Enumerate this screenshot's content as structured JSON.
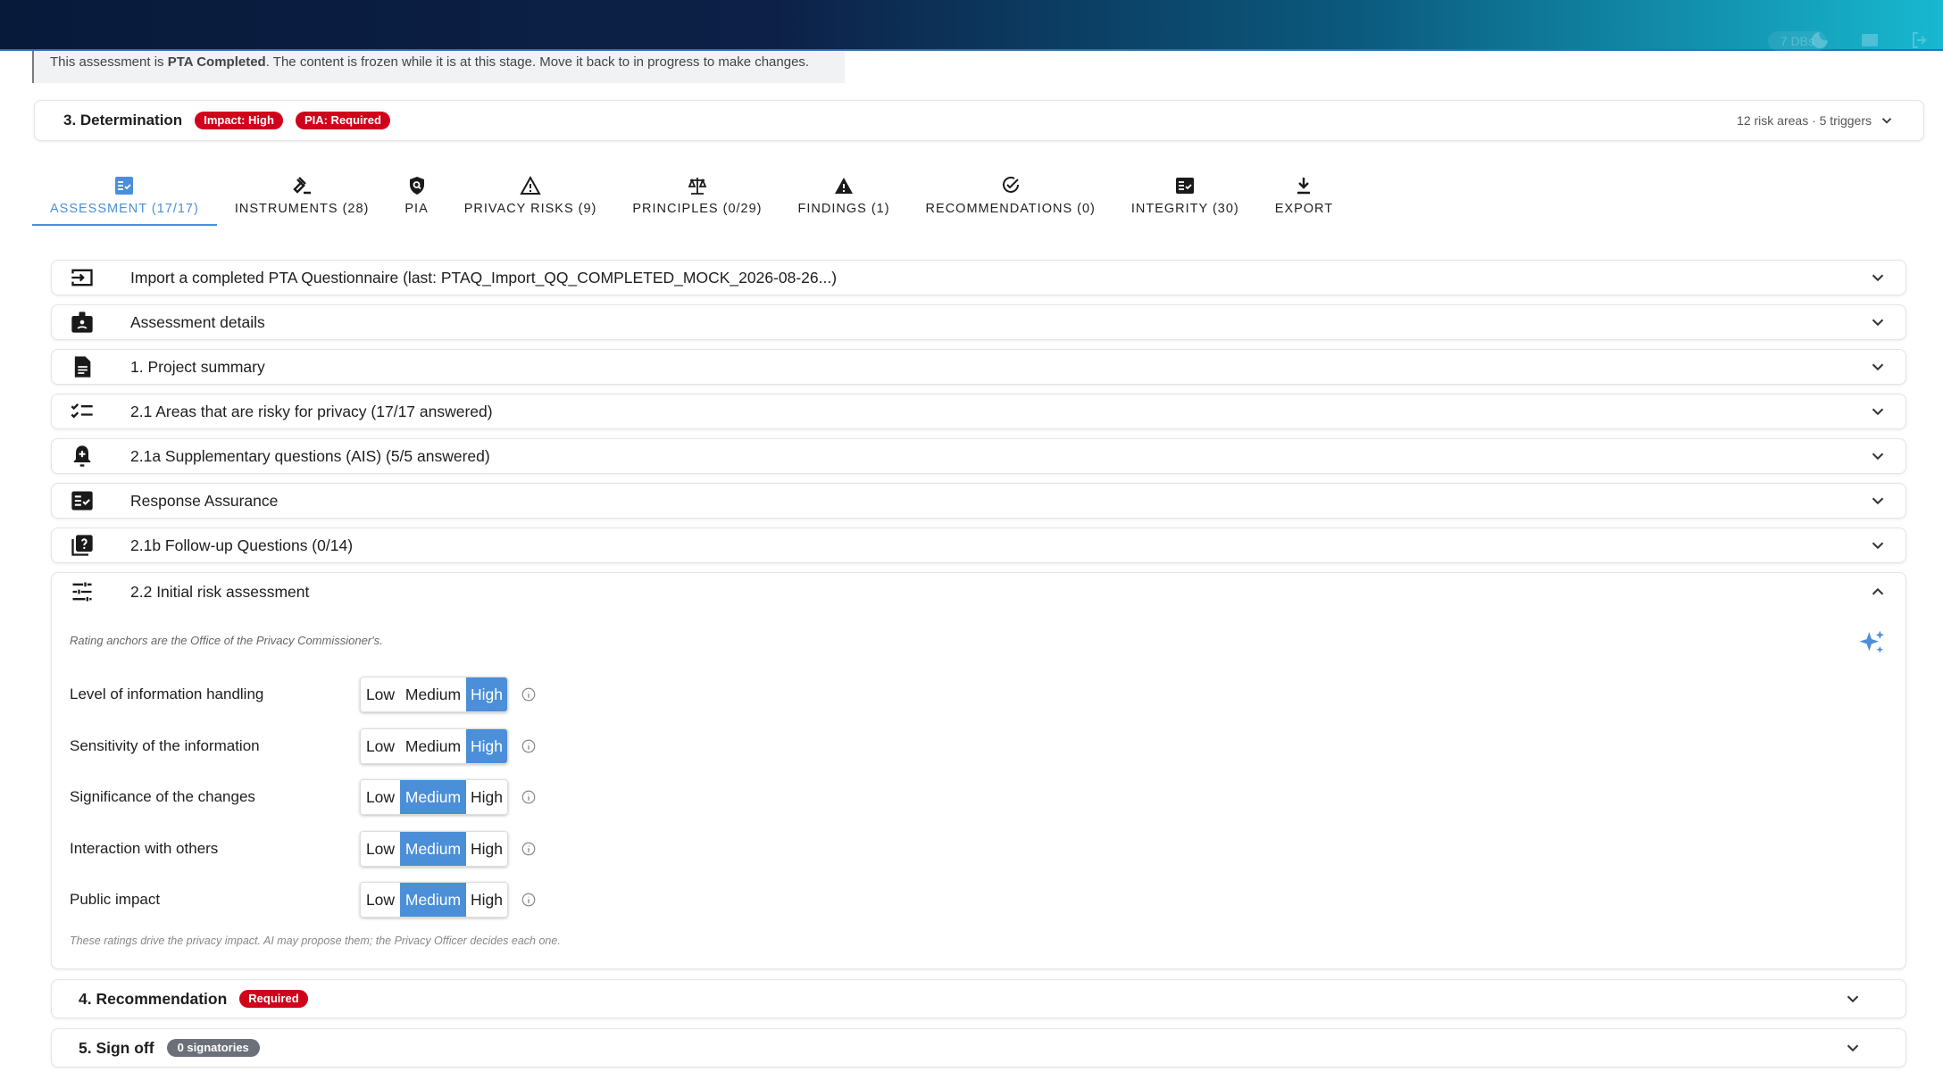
{
  "topbar": {
    "db_chip": "7 DBs",
    "icons": [
      "database-icon",
      "moon-icon",
      "window-icon",
      "logout-icon"
    ]
  },
  "banner": {
    "prefix": "This assessment is ",
    "status": "PTA Completed",
    "suffix": ". The content is frozen while it is at this stage. Move it back to in progress to make changes."
  },
  "determination": {
    "title": "3. Determination",
    "impact_chip": "Impact: High",
    "pia_chip": "PIA: Required",
    "meta": "12 risk areas · 5 triggers"
  },
  "tabs": [
    {
      "label": "ASSESSMENT (17/17)",
      "icon": "checklist-icon",
      "active": true
    },
    {
      "label": "INSTRUMENTS (28)",
      "icon": "gavel-icon"
    },
    {
      "label": "PIA",
      "icon": "shield-search-icon"
    },
    {
      "label": "PRIVACY RISKS (9)",
      "icon": "warning-outline-icon"
    },
    {
      "label": "PRINCIPLES (0/29)",
      "icon": "scales-icon"
    },
    {
      "label": "FINDINGS (1)",
      "icon": "warning-filled-icon"
    },
    {
      "label": "RECOMMENDATIONS (0)",
      "icon": "check-circle-icon"
    },
    {
      "label": "INTEGRITY (30)",
      "icon": "fact-check-icon"
    },
    {
      "label": "EXPORT",
      "icon": "download-icon"
    }
  ],
  "accordions": [
    {
      "label": "Import a completed PTA Questionnaire (last: PTAQ_Import_QQ_COMPLETED_MOCK_2026-08-26...)",
      "icon": "import-icon"
    },
    {
      "label": "Assessment details",
      "icon": "badge-icon"
    },
    {
      "label": "1. Project summary",
      "icon": "document-icon"
    },
    {
      "label": "2.1 Areas that are risky for privacy (17/17 answered)",
      "icon": "checklist-lines-icon"
    },
    {
      "label": "2.1a Supplementary questions (AIS) (5/5 answered)",
      "icon": "bell-plus-icon"
    },
    {
      "label": "Response Assurance",
      "icon": "fact-check-icon"
    },
    {
      "label": "2.1b Follow-up Questions (0/14)",
      "icon": "question-library-icon"
    }
  ],
  "risk_panel": {
    "label": "2.2 Initial risk assessment",
    "icon": "tune-icon",
    "anchor_note": "Rating anchors are the Office of the Privacy Commissioner's.",
    "options": {
      "low": "Low",
      "medium": "Medium",
      "high": "High"
    },
    "ratings": [
      {
        "label": "Level of information handling",
        "value": "High"
      },
      {
        "label": "Sensitivity of the information",
        "value": "High"
      },
      {
        "label": "Significance of the changes",
        "value": "Medium"
      },
      {
        "label": "Interaction with others",
        "value": "Medium"
      },
      {
        "label": "Public impact",
        "value": "Medium"
      }
    ],
    "footer_note": "These ratings drive the privacy impact. AI may propose them; the Privacy Officer decides each one."
  },
  "recommendation": {
    "title": "4. Recommendation",
    "chip": "Required"
  },
  "signoff": {
    "title": "5. Sign off",
    "chip": "0 signatories"
  }
}
